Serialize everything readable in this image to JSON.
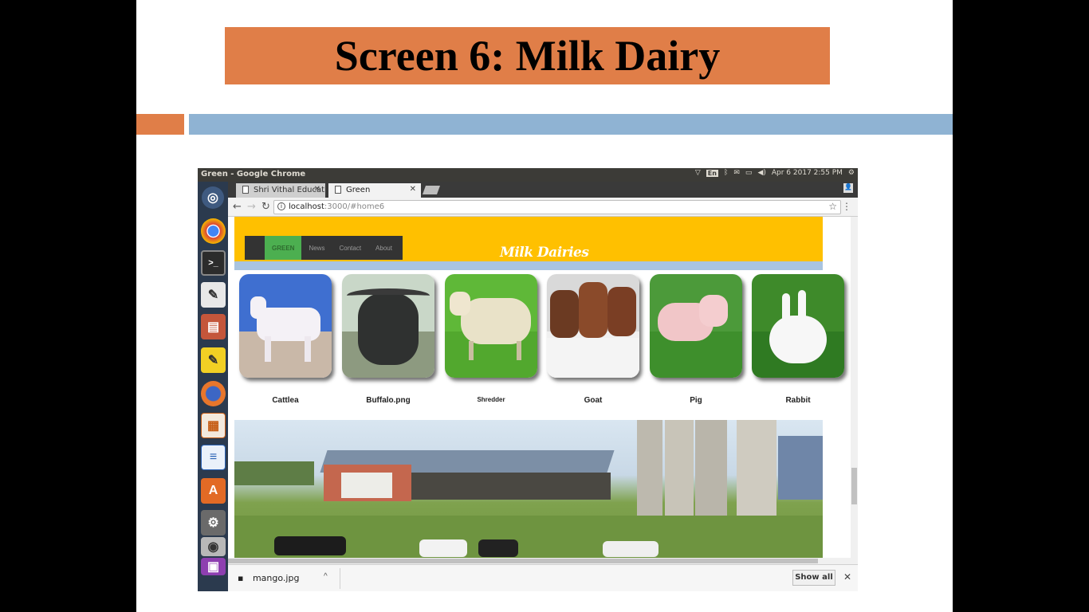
{
  "slide": {
    "title": "Screen 6: Milk Dairy"
  },
  "os": {
    "window_title": "Green - Google Chrome",
    "keyboard_layout": "En",
    "datetime": "Apr 6 2017 2:55 PM",
    "launcher_icons": [
      "ubuntu-logo-icon",
      "chrome-icon",
      "terminal-icon",
      "text-editor-icon",
      "file-manager-icon",
      "notes-icon",
      "firefox-icon",
      "impress-icon",
      "writer-icon",
      "software-center-icon",
      "settings-icon",
      "disk-icon",
      "trash-icon"
    ]
  },
  "browser": {
    "tabs": [
      {
        "label": "Shri Vithal Educati"
      },
      {
        "label": "Green"
      }
    ],
    "address": {
      "host": "localhost",
      "path": ":3000/#home6"
    }
  },
  "site": {
    "nav": [
      {
        "label": "GREEN",
        "active": true
      },
      {
        "label": "News",
        "active": false
      },
      {
        "label": "Contact",
        "active": false
      },
      {
        "label": "About",
        "active": false
      }
    ],
    "logo": "Milk Dairies",
    "animals": [
      {
        "caption": "Cattlea"
      },
      {
        "caption": "Buffalo.png"
      },
      {
        "caption": "Shredder"
      },
      {
        "caption": "Goat"
      },
      {
        "caption": "Pig"
      },
      {
        "caption": "Rabbit"
      }
    ]
  },
  "downloads": {
    "file": "mango.jpg",
    "show_all": "Show all"
  },
  "colors": {
    "title_bg": "#E07E48",
    "accent_blue": "#8FB3D3",
    "site_header": "#FFC000",
    "nav_active": "#4CAF50"
  }
}
